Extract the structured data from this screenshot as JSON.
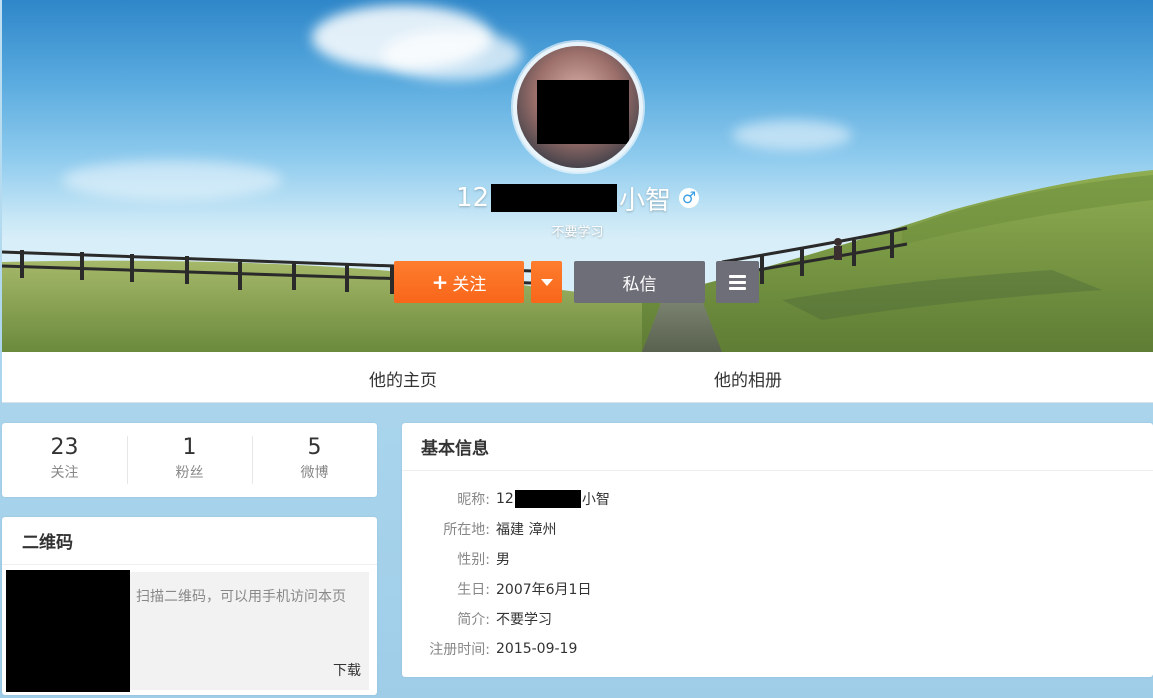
{
  "profile": {
    "nickname_prefix": "12",
    "nickname_suffix": "小智",
    "gender_symbol": "♂",
    "bio": "不要学习"
  },
  "actions": {
    "follow_plus": "+",
    "follow_label": "关注",
    "message_label": "私信"
  },
  "tabs": [
    {
      "label": "他的主页"
    },
    {
      "label": "他的相册"
    }
  ],
  "stats": [
    {
      "value": "23",
      "label": "关注"
    },
    {
      "value": "1",
      "label": "粉丝"
    },
    {
      "value": "5",
      "label": "微博"
    }
  ],
  "qr": {
    "title": "二维码",
    "text": "扫描二维码，可以用手机访问本页",
    "download": "下载"
  },
  "info": {
    "title": "基本信息",
    "rows": [
      {
        "key": "昵称:",
        "value_prefix": "12",
        "value_suffix": "小智"
      },
      {
        "key": "所在地:",
        "value": "福建 漳州"
      },
      {
        "key": "性别:",
        "value": "男"
      },
      {
        "key": "生日:",
        "value": "2007年6月1日"
      },
      {
        "key": "简介:",
        "value": "不要学习"
      },
      {
        "key": "注册时间:",
        "value": "2015-09-19"
      }
    ]
  },
  "colors": {
    "follow": "#f8661a",
    "message": "#6e6e78",
    "gender": "#3a9ee4"
  }
}
